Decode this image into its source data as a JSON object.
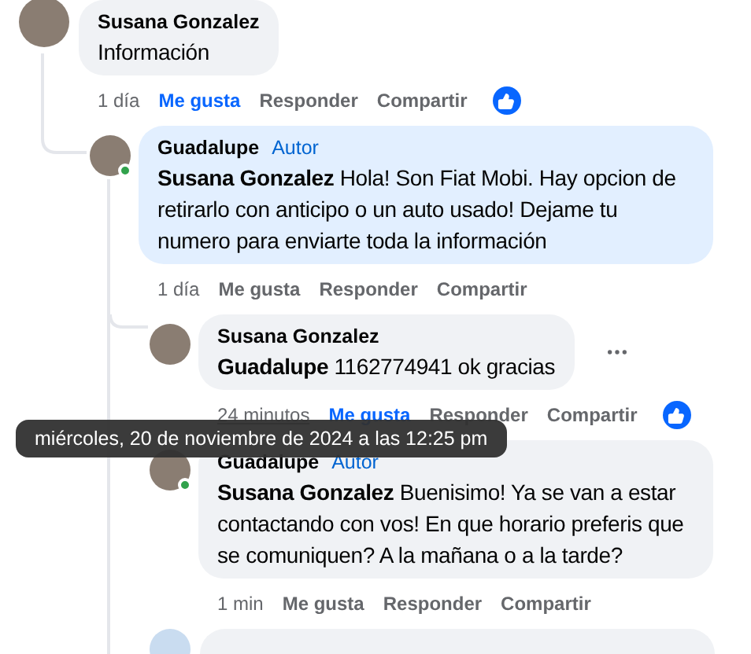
{
  "comments": [
    {
      "author": "Susana Gonzalez",
      "text": "Información",
      "time": "1 día",
      "time_hovered": false,
      "online": false,
      "highlighted": false,
      "menu_visible": false,
      "has_reaction": true,
      "actions": [
        {
          "label": "Me gusta",
          "selected": true
        },
        {
          "label": "Responder",
          "selected": false
        },
        {
          "label": "Compartir",
          "selected": false
        }
      ],
      "children": [
        {
          "author": "Guadalupe",
          "badge": "Autor",
          "mention": "Susana Gonzalez",
          "text": "Hola! Son Fiat Mobi. Hay opcion de retirarlo con anticipo o un auto usado! Dejame tu numero para enviarte toda la información",
          "time": "1 día",
          "time_hovered": false,
          "online": true,
          "highlighted": true,
          "menu_visible": false,
          "has_reaction": false,
          "actions": [
            {
              "label": "Me gusta",
              "selected": false
            },
            {
              "label": "Responder",
              "selected": false
            },
            {
              "label": "Compartir",
              "selected": false
            }
          ],
          "children": [
            {
              "author": "Susana Gonzalez",
              "mention": "Guadalupe",
              "text": "1162774941 ok gracias",
              "time": "24 minutos",
              "time_hovered": true,
              "online": false,
              "highlighted": false,
              "menu_visible": true,
              "has_reaction": true,
              "actions": [
                {
                  "label": "Me gusta",
                  "selected": true
                },
                {
                  "label": "Responder",
                  "selected": false
                },
                {
                  "label": "Compartir",
                  "selected": false
                }
              ]
            },
            {
              "author": "Guadalupe",
              "badge": "Autor",
              "mention": "Susana Gonzalez",
              "text": "Buenisimo! Ya se van a estar contactando con vos! En que horario preferis que se comuniquen? A la mañana o a la tarde?",
              "time": "1 min",
              "time_hovered": false,
              "online": true,
              "highlighted": false,
              "menu_visible": false,
              "has_reaction": false,
              "actions": [
                {
                  "label": "Me gusta",
                  "selected": false
                },
                {
                  "label": "Responder",
                  "selected": false
                },
                {
                  "label": "Compartir",
                  "selected": false
                }
              ]
            },
            {
              "kind": "partial"
            }
          ]
        }
      ]
    }
  ],
  "tooltip": {
    "text": "miércoles, 20 de noviembre de 2024 a las 12:25 pm"
  }
}
